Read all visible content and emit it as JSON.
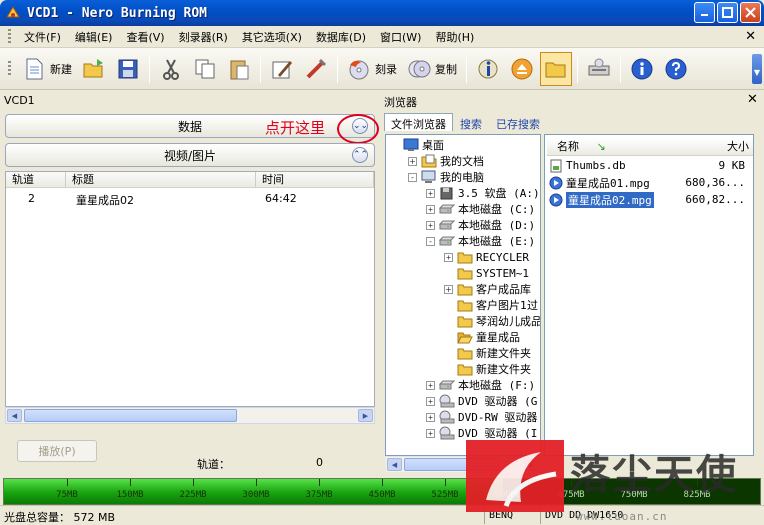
{
  "window": {
    "title": "VCD1 - Nero Burning ROM"
  },
  "menu": [
    "文件(F)",
    "编辑(E)",
    "查看(V)",
    "刻录器(R)",
    "其它选项(X)",
    "数据库(D)",
    "窗口(W)",
    "帮助(H)"
  ],
  "toolbar": {
    "new_label": "新建",
    "burn_label": "刻录",
    "copy_label": "复制"
  },
  "compilation": {
    "name": "VCD1",
    "sections": [
      {
        "label": "数据"
      },
      {
        "label": "视频/图片"
      }
    ],
    "annotation": "点开这里",
    "columns": [
      "轨道",
      "标题",
      "时间"
    ],
    "tracks": [
      {
        "track": "2",
        "title": "童星成品02",
        "time": "64:42"
      }
    ],
    "play_label": "播放(P)",
    "track_count_label": "轨道：",
    "track_count_value": "0"
  },
  "browser": {
    "title": "浏览器",
    "tabs": [
      "文件浏览器",
      "搜索",
      "已存搜索"
    ],
    "tree": [
      "桌面",
      "我的文档",
      "我的电脑",
      "3.5 软盘 (A:)",
      "本地磁盘 (C:)",
      "本地磁盘 (D:)",
      "本地磁盘 (E:)",
      "RECYCLER",
      "SYSTEM~1",
      "客户成品库",
      "客户图片1过",
      "琴润幼儿成品",
      "童星成品",
      "新建文件夹",
      "新建文件夹",
      "本地磁盘 (F:)",
      "DVD 驱动器 (G:)",
      "DVD-RW 驱动器 (",
      "DVD 驱动器 (I:)"
    ],
    "file_columns": [
      "名称",
      "大小"
    ],
    "files": [
      {
        "name": "Thumbs.db",
        "size": "9 KB"
      },
      {
        "name": "童星成品01.mpg",
        "size": "680,36..."
      },
      {
        "name": "童星成品02.mpg",
        "size": "660,82..."
      }
    ]
  },
  "capacity": {
    "ticks": [
      "75MB",
      "150MB",
      "225MB",
      "300MB",
      "375MB",
      "450MB",
      "525MB",
      "600MB",
      "675MB",
      "750MB",
      "825MB"
    ],
    "used_fraction": 0.66
  },
  "status": {
    "capacity_label": "光盘总容量： 572 MB",
    "device": "BENQ",
    "drive": "DVD DD DW1650"
  },
  "watermark": {
    "brand": "落尘天使",
    "url": "www.luoan.cn"
  }
}
